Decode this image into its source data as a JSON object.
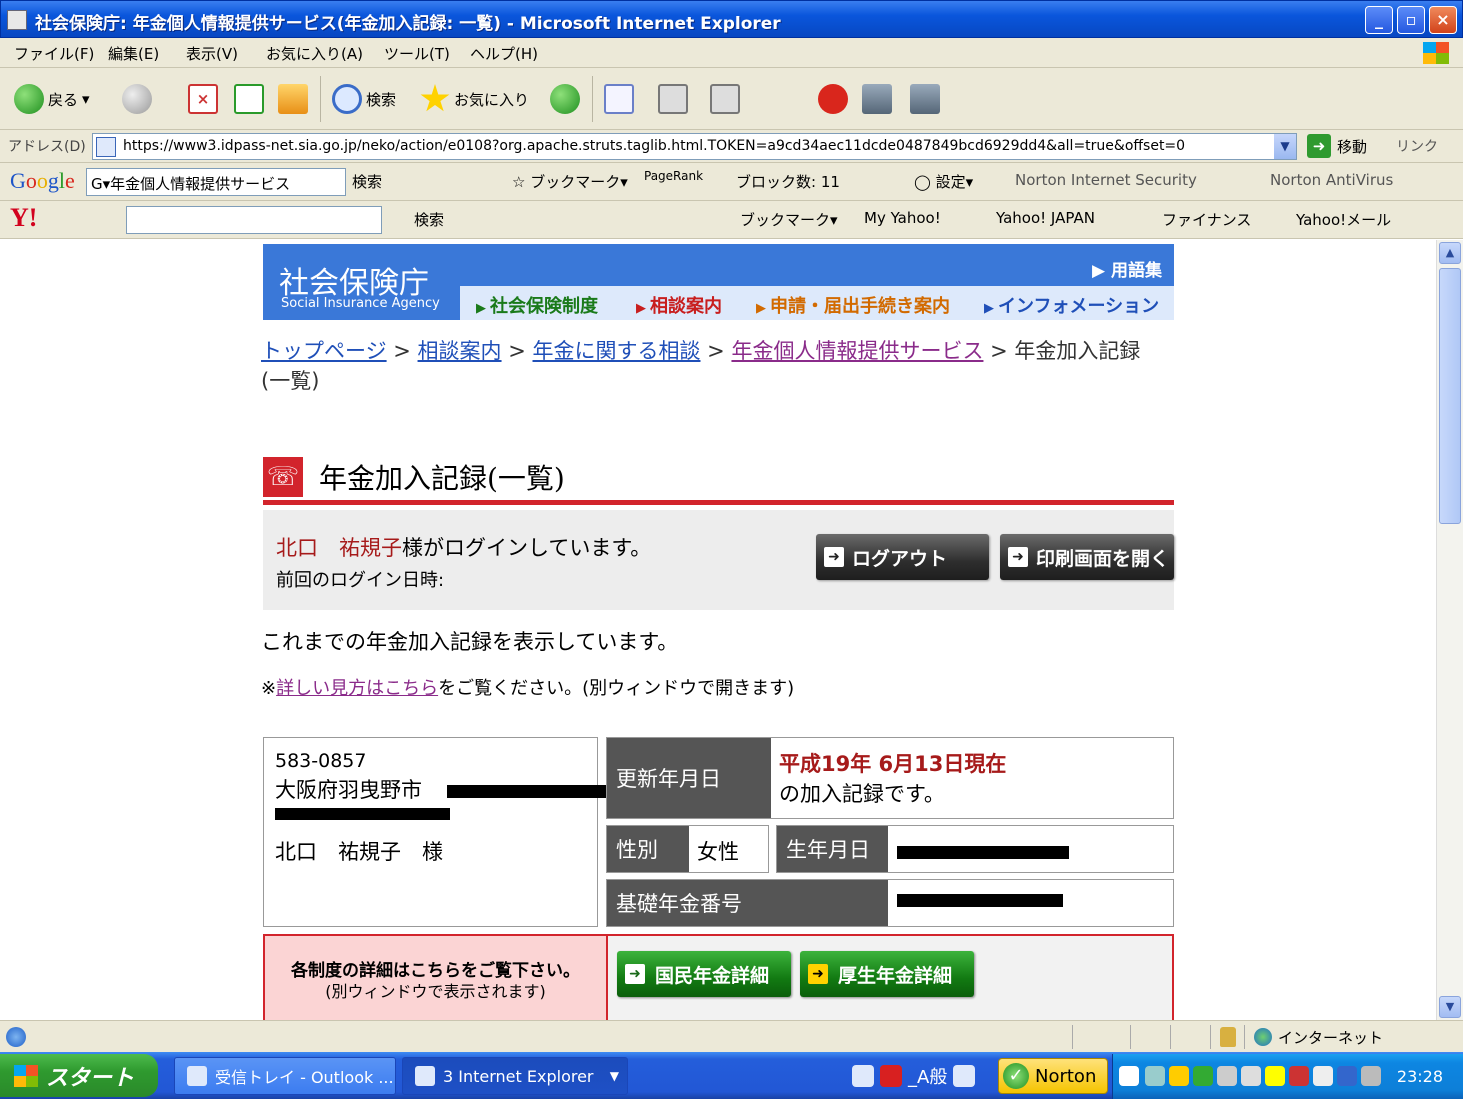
{
  "window": {
    "title": "社会保険庁: 年金個人情報提供サービス(年金加入記録: 一覧) - Microsoft Internet Explorer",
    "minimize": "_",
    "maximize": "▫",
    "close": "×"
  },
  "menu": [
    "ファイル(F)",
    "編集(E)",
    "表示(V)",
    "お気に入り(A)",
    "ツール(T)",
    "ヘルプ(H)"
  ],
  "toolbar": {
    "back": "戻る",
    "search": "検索",
    "favorites": "お気に入り"
  },
  "address": {
    "label": "アドレス(D)",
    "url": "https://www3.idpass-net.sia.go.jp/neko/action/e0108?org.apache.struts.taglib.html.TOKEN=a9cd34aec11dcde0487849bcd6929dd4&all=true&offset=0",
    "go": "移動",
    "links": "リンク"
  },
  "google_bar": {
    "logo": "Google",
    "search_text": "G▾年金個人情報提供サービス",
    "search": "検索",
    "bookmarks": "ブックマーク▾",
    "pagerank": "PageRank",
    "blocked": "ブロック数: 11",
    "settings": "設定▾",
    "norton_is": "Norton Internet Security",
    "norton_av": "Norton AntiVirus"
  },
  "yahoo_bar": {
    "logo": "Y!",
    "search": "検索",
    "bookmarks": "ブックマーク▾",
    "my_yahoo": "My Yahoo!",
    "yahoo_japan": "Yahoo! JAPAN",
    "finance": "ファイナンス",
    "mail": "Yahoo!メール"
  },
  "site": {
    "name_jp": "社会保険庁",
    "name_en": "Social Insurance Agency",
    "glossary": "用語集",
    "nav": [
      "社会保険制度",
      "相談案内",
      "申請・届出手続き案内",
      "インフォメーション"
    ],
    "colors": {
      "header_blue": "#3a78d8",
      "accent_red": "#d2242c",
      "nav_green": "#1a7a1a",
      "nav_red": "#c81e1e",
      "nav_orange": "#d26a00",
      "nav_blue": "#1f4fb8"
    }
  },
  "breadcrumbs": [
    "トップページ",
    "相談案内",
    "年金に関する相談",
    "年金個人情報提供サービス",
    "年金加入記録(一覧)"
  ],
  "page": {
    "heading": "年金加入記録(一覧)",
    "user_name": "北口　祐規子",
    "login_suffix": "様がログインしています。",
    "last_login": "前回のログイン日時:",
    "logout": "ログアウト",
    "print": "印刷画面を開く",
    "intro": "これまでの年金加入記録を表示しています。",
    "note_prefix": "※",
    "note_link": "詳しい見方はこちら",
    "note_suffix": "をご覧ください。(別ウィンドウで開きます)"
  },
  "address_card": {
    "zip": "583-0857",
    "city": "大阪府羽曳野市",
    "holder": "北口　祐規子　様"
  },
  "record": {
    "update_label": "更新年月日",
    "update_date": "平成19年 6月13日現在",
    "update_suffix": "の加入記録です。",
    "gender_label": "性別",
    "gender": "女性",
    "birth_label": "生年月日",
    "basic_no_label": "基礎年金番号"
  },
  "details": {
    "line1": "各制度の詳細はこちらをご覧下さい。",
    "line2": "(別ウィンドウで表示されます)",
    "national": "国民年金詳細",
    "employee": "厚生年金詳細"
  },
  "statusbar": {
    "zone": "インターネット"
  },
  "taskbar": {
    "start": "スタート",
    "task1": "受信トレイ - Outlook ...",
    "task2": "3 Internet Explorer",
    "ime": "_A般",
    "norton": "Norton",
    "clock": "23:28"
  }
}
